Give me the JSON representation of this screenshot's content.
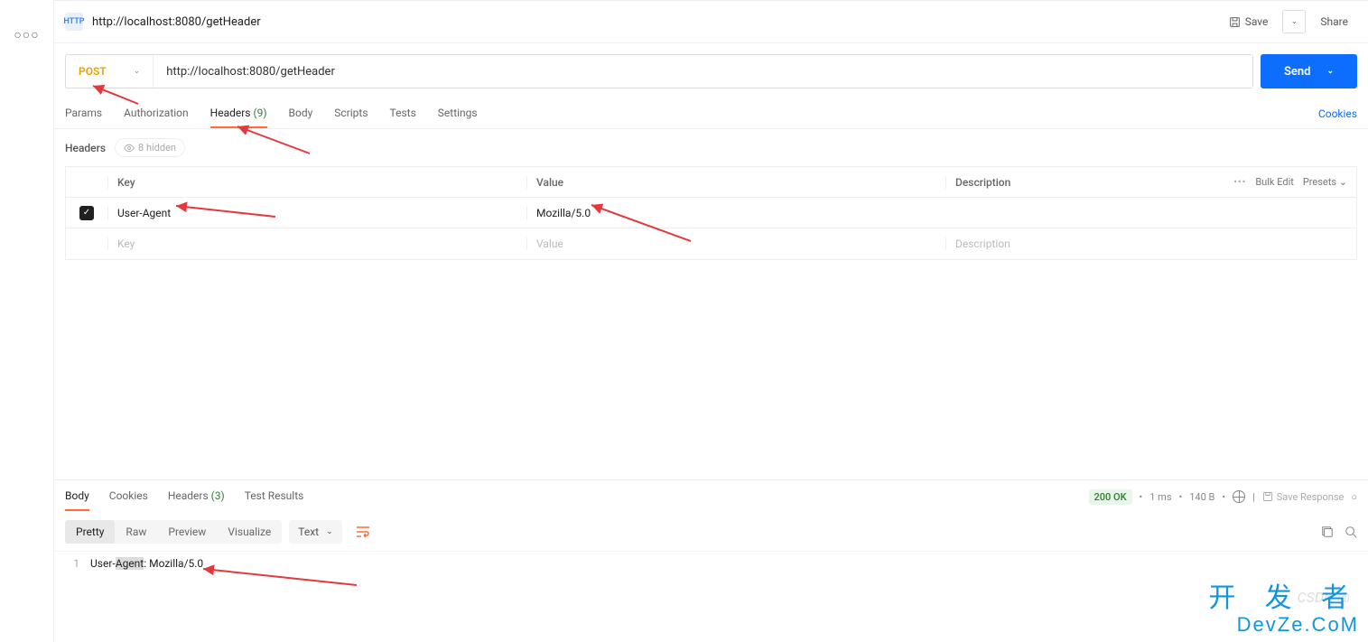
{
  "title": {
    "url": "http://localhost:8080/getHeader"
  },
  "actions": {
    "save": "Save",
    "share": "Share"
  },
  "request": {
    "method": "POST",
    "url": "http://localhost:8080/getHeader",
    "send": "Send"
  },
  "tabs": {
    "params": "Params",
    "auth": "Authorization",
    "headers": "Headers",
    "headers_count": "(9)",
    "body": "Body",
    "scripts": "Scripts",
    "tests": "Tests",
    "settings": "Settings",
    "cookies": "Cookies"
  },
  "headers_section": {
    "label": "Headers",
    "hidden": "8 hidden"
  },
  "table": {
    "head": {
      "key": "Key",
      "value": "Value",
      "desc": "Description",
      "bulk": "Bulk Edit",
      "presets": "Presets"
    },
    "row0": {
      "key": "User-Agent",
      "value": "Mozilla/5.0",
      "desc": ""
    },
    "placeholders": {
      "key": "Key",
      "value": "Value",
      "desc": "Description"
    }
  },
  "response": {
    "tabs": {
      "body": "Body",
      "cookies": "Cookies",
      "headers": "Headers",
      "headers_count": "(3)",
      "tests": "Test Results"
    },
    "status": {
      "code": "200 OK",
      "time": "1 ms",
      "size": "140 B",
      "save": "Save Response"
    },
    "views": {
      "pretty": "Pretty",
      "raw": "Raw",
      "preview": "Preview",
      "visualize": "Visualize",
      "type": "Text"
    },
    "body_line_no": "1",
    "body_prefix": "User-",
    "body_hl": "Agent",
    "body_suffix": ": Mozilla/5.0"
  },
  "watermarks": {
    "csdn": "CSDN @",
    "cn": "开 发 者",
    "en": "DevZe.CoM"
  }
}
